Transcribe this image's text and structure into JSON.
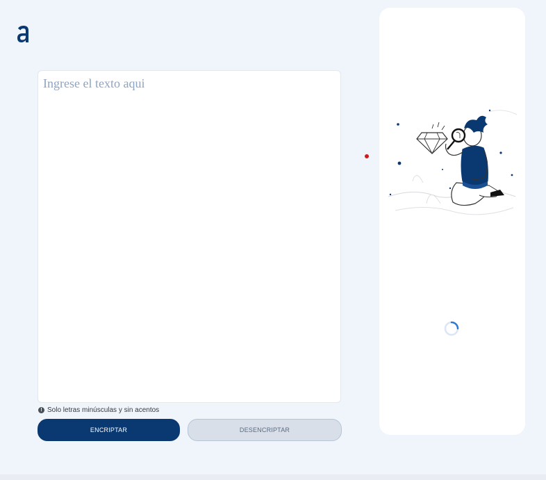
{
  "app": {
    "logo_icon": "alura-a-logo-icon",
    "accent_color": "#0a3871"
  },
  "input": {
    "placeholder": "Ingrese el texto aqui",
    "value": ""
  },
  "hint": {
    "icon": "exclamation-circle-icon",
    "text": "Solo letras minúsculas y sin acentos"
  },
  "buttons": {
    "encrypt_label": "ENCRIPTAR",
    "decrypt_label": "DESENCRIPTAR"
  },
  "output": {
    "illustration": "person-with-magnifying-glass-icon",
    "loading_icon": "loading-spinner-icon"
  }
}
